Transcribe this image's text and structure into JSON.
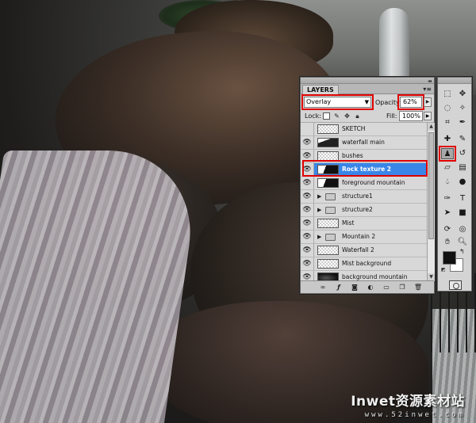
{
  "watermark": {
    "logo": "Inwet资源素材站",
    "url": "www.52inwet.com"
  },
  "layers_panel": {
    "tab": "LAYERS",
    "menu_icon": "panel-menu-icon",
    "blend_mode": "Overlay",
    "opacity_label": "Opacity:",
    "opacity_value": "62%",
    "lock_label": "Lock:",
    "fill_label": "Fill:",
    "fill_value": "100%",
    "layers": [
      {
        "name": "SKETCH",
        "visible": false,
        "kind": "layer"
      },
      {
        "name": "waterfall main",
        "visible": true,
        "kind": "layer"
      },
      {
        "name": "bushes",
        "visible": true,
        "kind": "layer"
      },
      {
        "name": "Rock texture 2",
        "visible": true,
        "kind": "layer",
        "selected": true
      },
      {
        "name": "foreground mountain",
        "visible": true,
        "kind": "layer"
      },
      {
        "name": "structure1",
        "visible": true,
        "kind": "group"
      },
      {
        "name": "structure2",
        "visible": true,
        "kind": "group"
      },
      {
        "name": "Mist",
        "visible": true,
        "kind": "layer"
      },
      {
        "name": "Mountain 2",
        "visible": true,
        "kind": "group"
      },
      {
        "name": "Waterfall 2",
        "visible": true,
        "kind": "layer"
      },
      {
        "name": "Mist background",
        "visible": true,
        "kind": "layer"
      },
      {
        "name": "background mountain",
        "visible": true,
        "kind": "layer"
      }
    ],
    "bottom_icons": [
      "link-icon",
      "fx-icon",
      "mask-icon",
      "adjustment-icon",
      "group-icon",
      "new-layer-icon",
      "trash-icon"
    ]
  },
  "tools_panel": {
    "selected_tool": "clone-stamp-tool",
    "foreground_color": "#111111",
    "background_color": "#ffffff"
  }
}
